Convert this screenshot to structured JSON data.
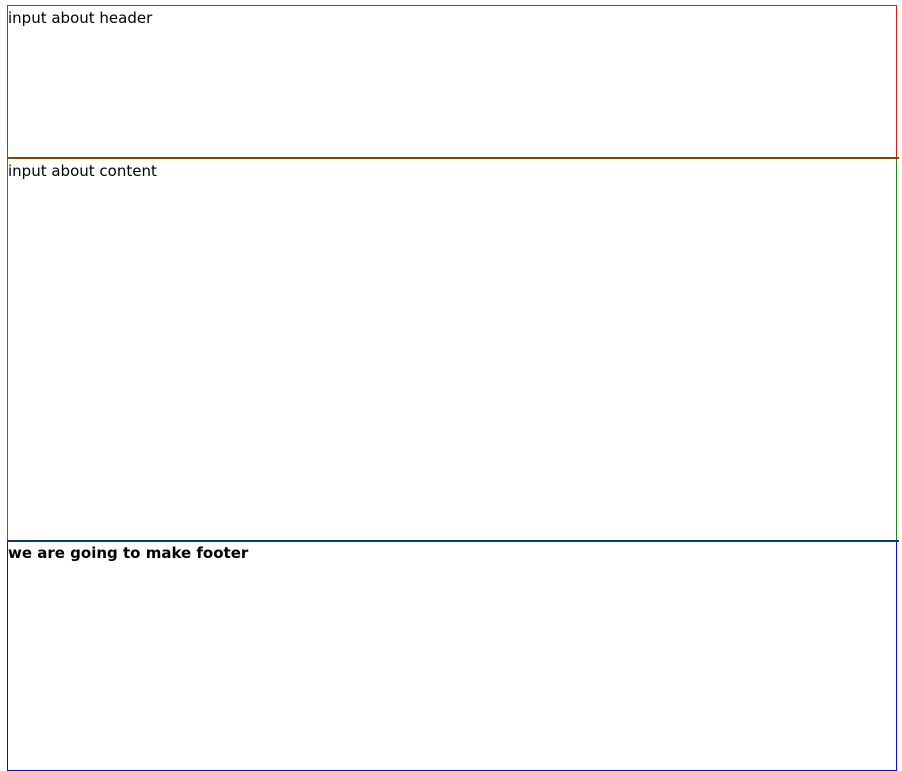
{
  "header": {
    "text": "input about header",
    "border_color": "#e01b1b"
  },
  "content": {
    "text": "input about content",
    "border_color": "#1a8a1a"
  },
  "footer": {
    "text": "we are going to make footer",
    "border_color": "#1010c8"
  }
}
